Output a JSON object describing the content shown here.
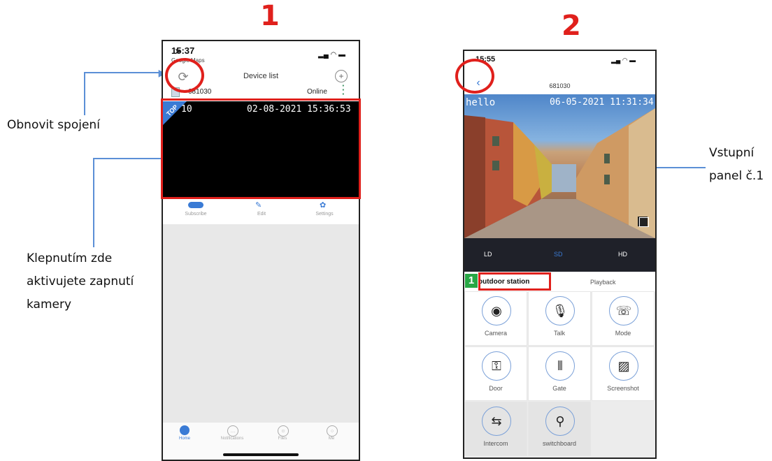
{
  "step1": {
    "number": "1",
    "status_time": "15:37",
    "status_back_app": "Google Maps",
    "header_title": "Device list",
    "device_id": "681030",
    "device_status": "Online",
    "video_timestamp": "02-08-2021 15:36:53",
    "video_badge": "TOP",
    "video_overlay": "10",
    "actions": [
      "Subscribe",
      "Edit",
      "Settings"
    ],
    "tabbar": [
      "Home",
      "Notifications",
      "Files",
      "Me"
    ]
  },
  "step2": {
    "number": "2",
    "status_time": "15:55",
    "header_title": "681030",
    "video_overlay_left": "hello",
    "video_timestamp": "06-05-2021 11:31:34",
    "quality": [
      "LD",
      "SD",
      "HD"
    ],
    "tabs": [
      "outdoor station",
      "Playback"
    ],
    "tab_marker": "1",
    "controls": [
      "Camera",
      "Talk",
      "Mode",
      "Door",
      "Gate",
      "Screenshot",
      "Intercom",
      "switchboard"
    ]
  },
  "annotations": {
    "refresh": "Obnovit spojení",
    "tap_line1": "Klepnutím zde",
    "tap_line2": "aktivujete zapnutí",
    "tap_line3": "kamery",
    "panel_line1": "Vstupní",
    "panel_line2": "panel č.1"
  },
  "colors": {
    "accent_red": "#e0201c",
    "line_blue": "#5b8fd6",
    "app_blue": "#3a7bd5"
  }
}
